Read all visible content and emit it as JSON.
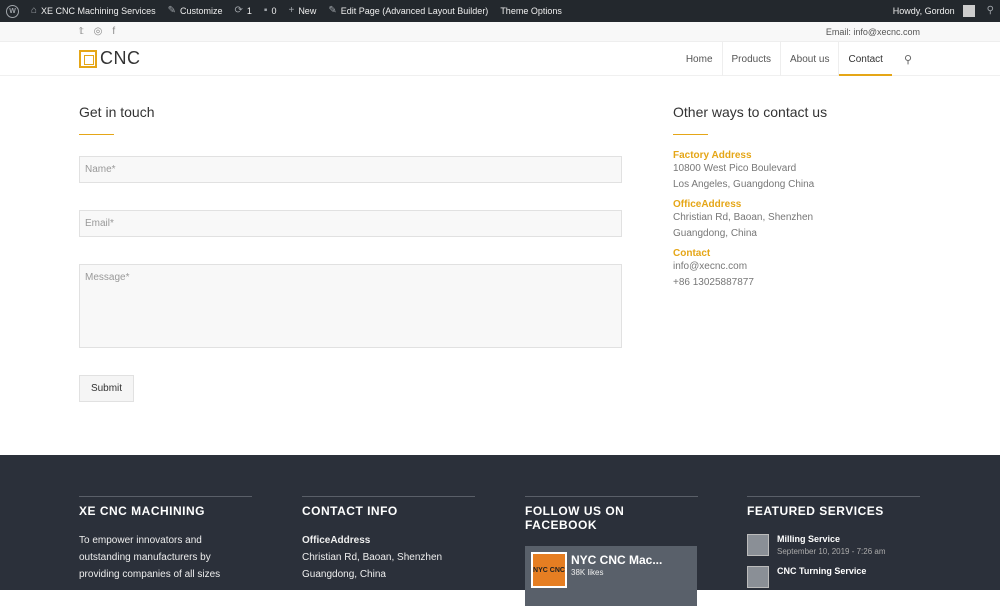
{
  "adminbar": {
    "site": "XE CNC Machining Services",
    "customize": "Customize",
    "updates": "1",
    "comments": "0",
    "new": "New",
    "edit": "Edit Page (Advanced Layout Builder)",
    "theme": "Theme Options",
    "howdy": "Howdy, Gordon"
  },
  "topbar": {
    "social_icons": [
      "twitter-icon",
      "dribbble-icon",
      "facebook-icon"
    ],
    "email": "Email: info@xecnc.com"
  },
  "header": {
    "logo_text": "CNC",
    "nav": [
      "Home",
      "Products",
      "About us",
      "Contact"
    ],
    "active": "Contact",
    "accent": "#e5a617"
  },
  "form": {
    "title": "Get in touch",
    "name_placeholder": "Name*",
    "email_placeholder": "Email*",
    "message_placeholder": "Message*",
    "submit": "Submit"
  },
  "contact": {
    "title": "Other ways to contact us",
    "factory_head": "Factory Address",
    "factory_lines": [
      "10800 West Pico Boulevard",
      "Los Angeles, Guangdong China"
    ],
    "office_head": "OfficeAddress",
    "office_lines": [
      "Christian Rd, Baoan, Shenzhen",
      "Guangdong, China"
    ],
    "contact_head": "Contact",
    "contact_lines": [
      "info@xecnc.com",
      "+86 13025887877"
    ]
  },
  "footer": {
    "col1_title": "XE CNC MACHINING",
    "col1_lines": [
      "To empower innovators and",
      "outstanding manufacturers by",
      "providing companies of all sizes"
    ],
    "col2_title": "CONTACT INFO",
    "col2_head": "OfficeAddress",
    "col2_lines": [
      "Christian Rd, Baoan, Shenzhen",
      "Guangdong, China"
    ],
    "col3_title": "FOLLOW US ON FACEBOOK",
    "fb_page": "NYC CNC Mac...",
    "fb_likes": "38K likes",
    "fb_thumb": "NYC CNC",
    "col4_title": "FEATURED SERVICES",
    "services": [
      {
        "title": "Milling Service",
        "date": "September 10, 2019 - 7:26 am"
      },
      {
        "title": "CNC Turning Service",
        "date": ""
      }
    ]
  }
}
